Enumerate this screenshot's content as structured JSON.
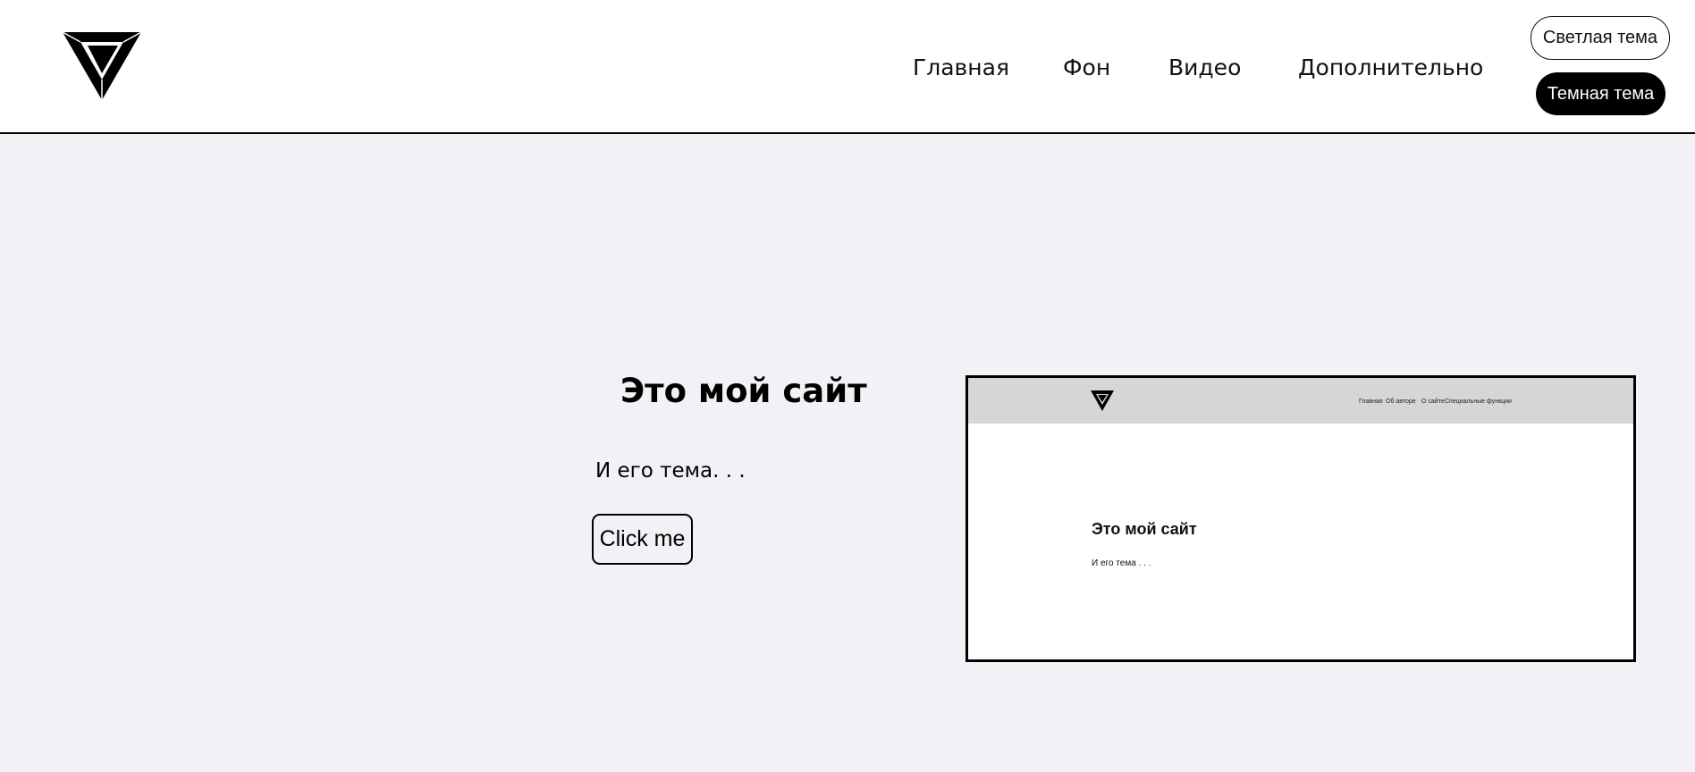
{
  "header": {
    "logo_icon": "impossible-triangle-logo-icon",
    "nav": [
      {
        "label": "Главная"
      },
      {
        "label": "Фон"
      },
      {
        "label": "Видео"
      },
      {
        "label": "Дополнительно"
      }
    ],
    "theme_light_label": "Светлая тема",
    "theme_dark_label": "Темная тема"
  },
  "hero": {
    "title": "Это мой сайт",
    "subtitle": "И его тема. . .",
    "button_label": "Click me"
  },
  "preview": {
    "nav": [
      "Главная",
      "Об авторе",
      "О сайте",
      "Специальные функции"
    ],
    "title": "Это мой сайт",
    "subtitle": "И его тема . . ."
  },
  "colors": {
    "page_background": "#f2f1f5",
    "header_background": "#ffffff",
    "accent": "#000000",
    "preview_header": "#d6d6d6"
  }
}
